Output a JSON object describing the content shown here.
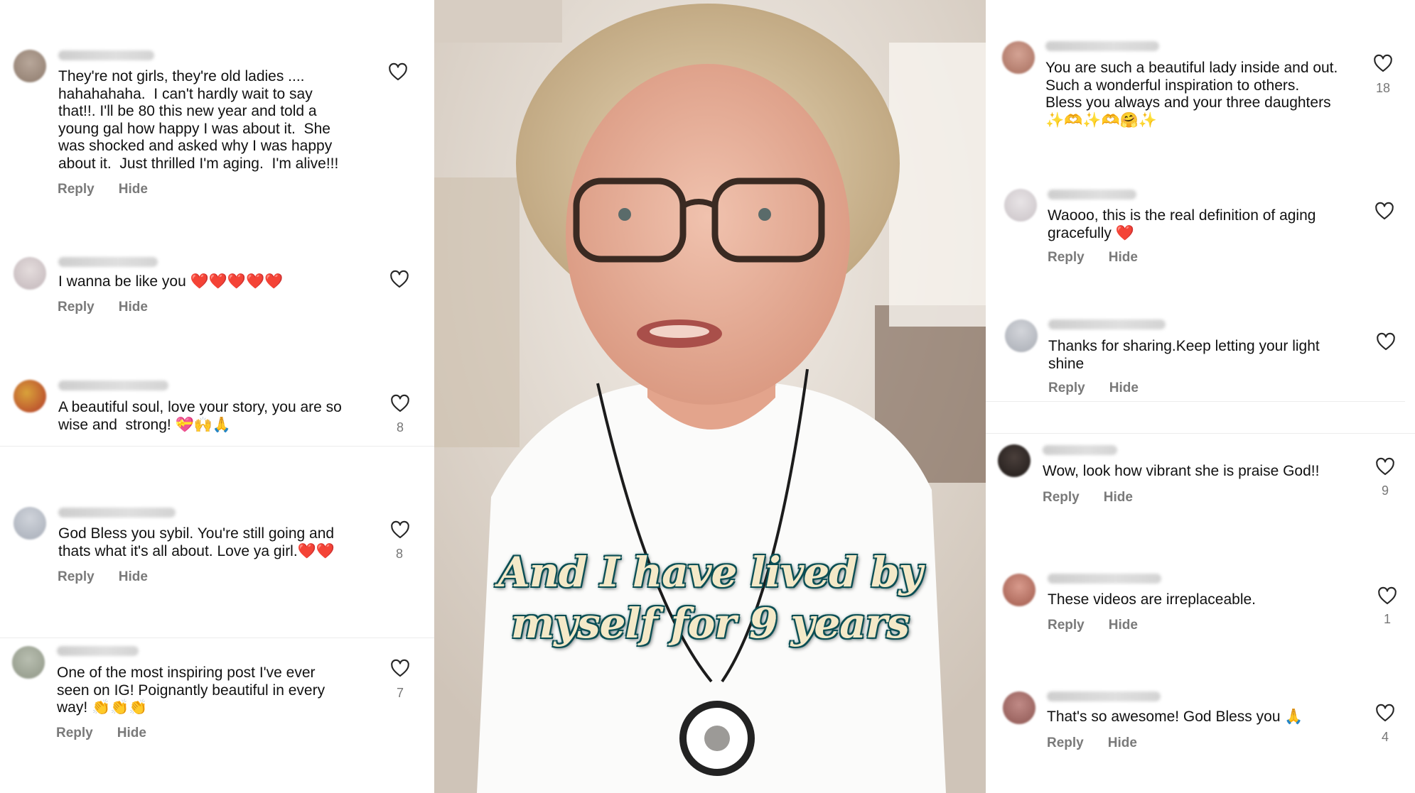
{
  "actions": {
    "reply": "Reply",
    "hide": "Hide"
  },
  "video": {
    "caption_line1": "And I have lived by",
    "caption_line2": "myself for 9 years"
  },
  "left_comments": [
    {
      "text": "They're not girls, they're old ladies ....\nhahahahaha.  I can't hardly wait to say\nthat!!. I'll be 80 this new year and told a\nyoung gal how happy I was about it.  She\nwas shocked and asked why I was happy\nabout it.  Just thrilled I'm aging.  I'm alive!!!",
      "likes": ""
    },
    {
      "text": "I wanna be like you ❤️❤️❤️❤️❤️",
      "likes": ""
    },
    {
      "text": "A beautiful soul, love your story, you are so\nwise and  strong! 💝🙌🙏",
      "likes": "8"
    },
    {
      "text": "God Bless you sybil. You're still going and\nthats what it's all about. Love ya girl.❤️❤️",
      "likes": "8"
    },
    {
      "text": "One of the most inspiring post I've ever\nseen on IG! Poignantly beautiful in every\nway! 👏👏👏",
      "likes": "7"
    }
  ],
  "right_comments": [
    {
      "text": "You are such a beautiful lady inside and out.\nSuch a wonderful inspiration to others.\nBless you always and your three daughters\n✨🫶✨🫶🤗✨",
      "likes": "18"
    },
    {
      "text": "Waooo, this is the real definition of aging\ngracefully ❤️",
      "likes": ""
    },
    {
      "text": "Thanks for sharing.Keep letting your light\nshine",
      "likes": ""
    },
    {
      "text": "Wow, look how vibrant she is praise God!!",
      "likes": "9"
    },
    {
      "text": "These videos are irreplaceable.",
      "likes": "1"
    },
    {
      "text": "That's so awesome! God Bless you 🙏",
      "likes": "4"
    }
  ],
  "colors": {
    "caption_fill": "#f4e9c8",
    "caption_outline": "#0c4f55",
    "action_gray": "#7a7a7a"
  }
}
